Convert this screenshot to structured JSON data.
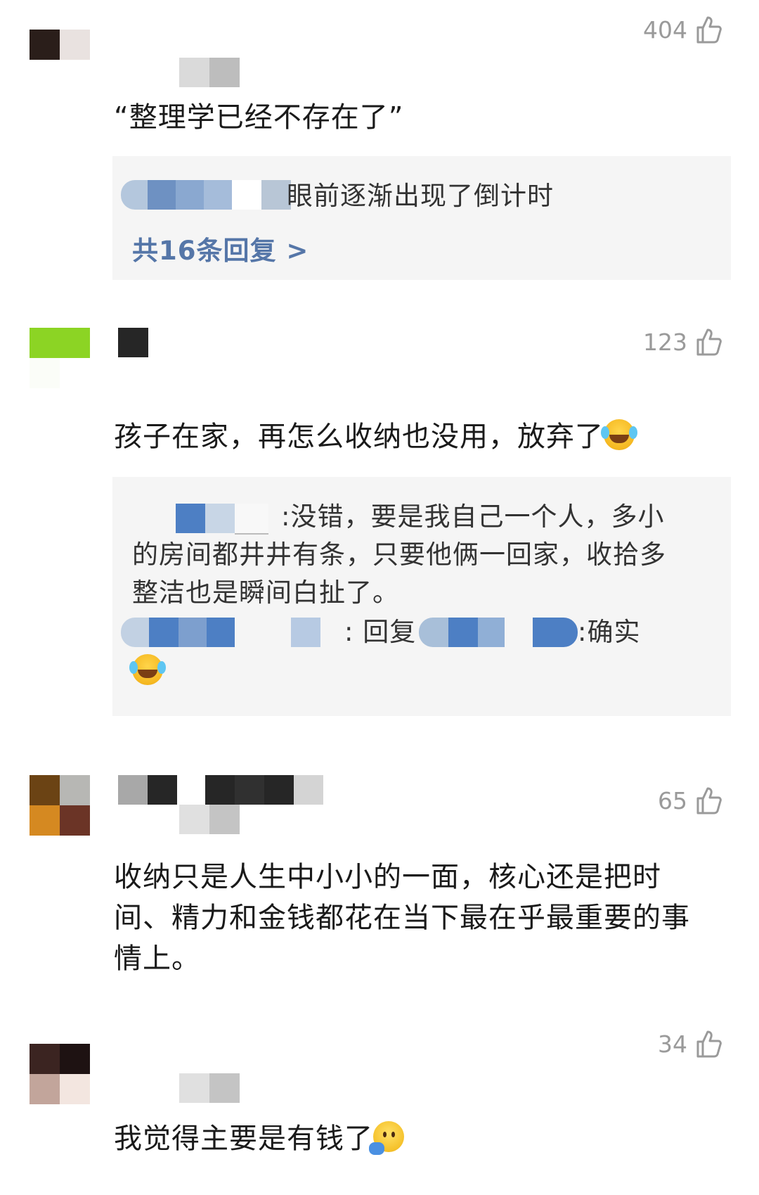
{
  "comments": [
    {
      "likes": "404",
      "text": "“整理学已经不存在了”",
      "reply": {
        "preview_text": "眼前逐渐出现了倒计时",
        "more_label": "共16条回复 >"
      }
    },
    {
      "likes": "123",
      "text": "孩子在家，再怎么收纳也没用，放弃了",
      "emoji": "laughing-tears-emoji",
      "reply": {
        "line1": ":没错，要是我自己一个人，多小",
        "line2": "的房间都井井有条，只要他俩一回家，收拾多",
        "line3": "整洁也是瞬间白扯了。",
        "reply_sep": ": 回复",
        "reply_text": ":确实",
        "reply_emoji": "laughing-tears-emoji"
      }
    },
    {
      "likes": "65",
      "text_lines": [
        "收纳只是人生中小小的一面，核心还是把时",
        "间、精力和金钱都花在当下最在乎最重要的事",
        "情上。"
      ]
    },
    {
      "likes": "34",
      "text": "我觉得主要是有钱了",
      "emoji": "salute-emoji"
    }
  ],
  "icons": {
    "like": "thumbs-up-icon"
  },
  "colors": {
    "link": "#5576a8",
    "like_count": "#9a9a9a",
    "reply_bg": "#f5f5f5"
  }
}
